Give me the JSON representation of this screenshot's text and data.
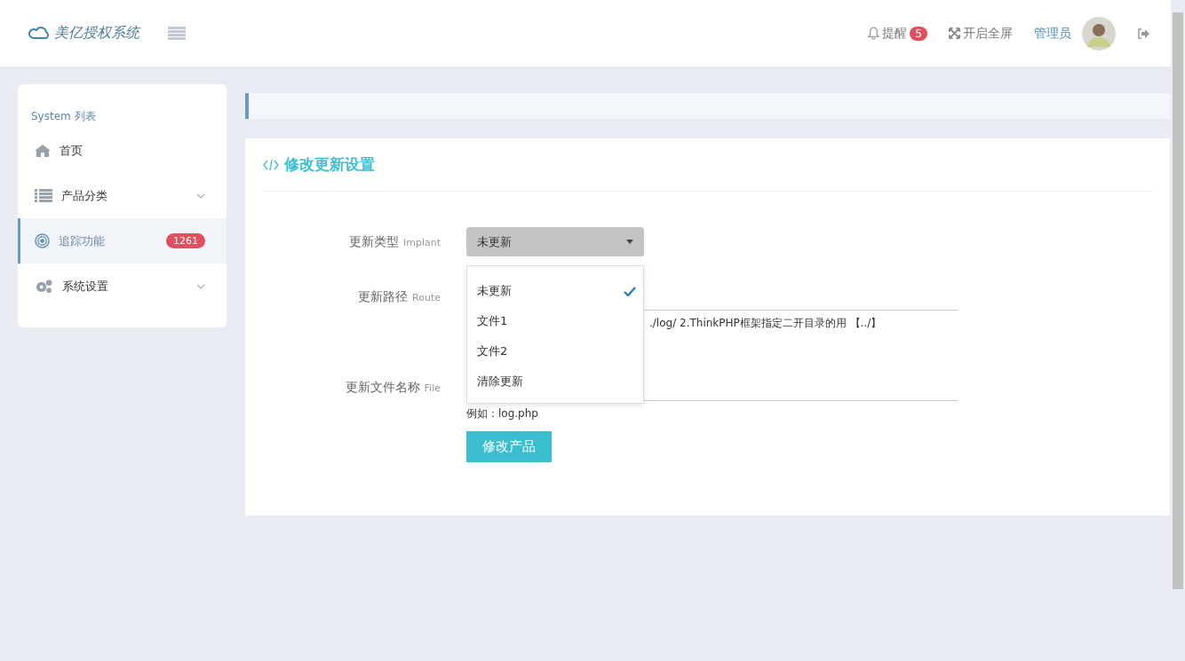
{
  "header": {
    "logo": "美亿授权系统",
    "notifications": {
      "label": "提醒",
      "count": "5"
    },
    "fullscreen": "开启全屏",
    "user": "管理员"
  },
  "sidebar": {
    "title": "System 列表",
    "items": [
      {
        "label": "首页",
        "selected": false,
        "expandable": false
      },
      {
        "label": "产品分类",
        "selected": false,
        "expandable": true
      },
      {
        "label": "追踪功能",
        "selected": true,
        "expandable": false,
        "badge": "1261"
      },
      {
        "label": "系统设置",
        "selected": false,
        "expandable": true
      }
    ]
  },
  "panel": {
    "title": "修改更新设置",
    "fields": [
      {
        "kind": "select",
        "label": "更新类型",
        "sublabel": "Implant",
        "value": "未更新",
        "expanded": true,
        "options": [
          {
            "label": "未更新",
            "selected": true
          },
          {
            "label": "文件1",
            "selected": false
          },
          {
            "label": "文件2",
            "selected": false
          },
          {
            "label": "清除更新",
            "selected": false
          }
        ]
      },
      {
        "kind": "text",
        "label": "更新路径",
        "sublabel": "Route",
        "help": "./log/ 2.ThinkPHP框架指定二开目录的用 【../】"
      },
      {
        "kind": "text",
        "label": "更新文件名称",
        "sublabel": "File",
        "help": "例如：log.php"
      }
    ],
    "submit": "修改产品"
  }
}
